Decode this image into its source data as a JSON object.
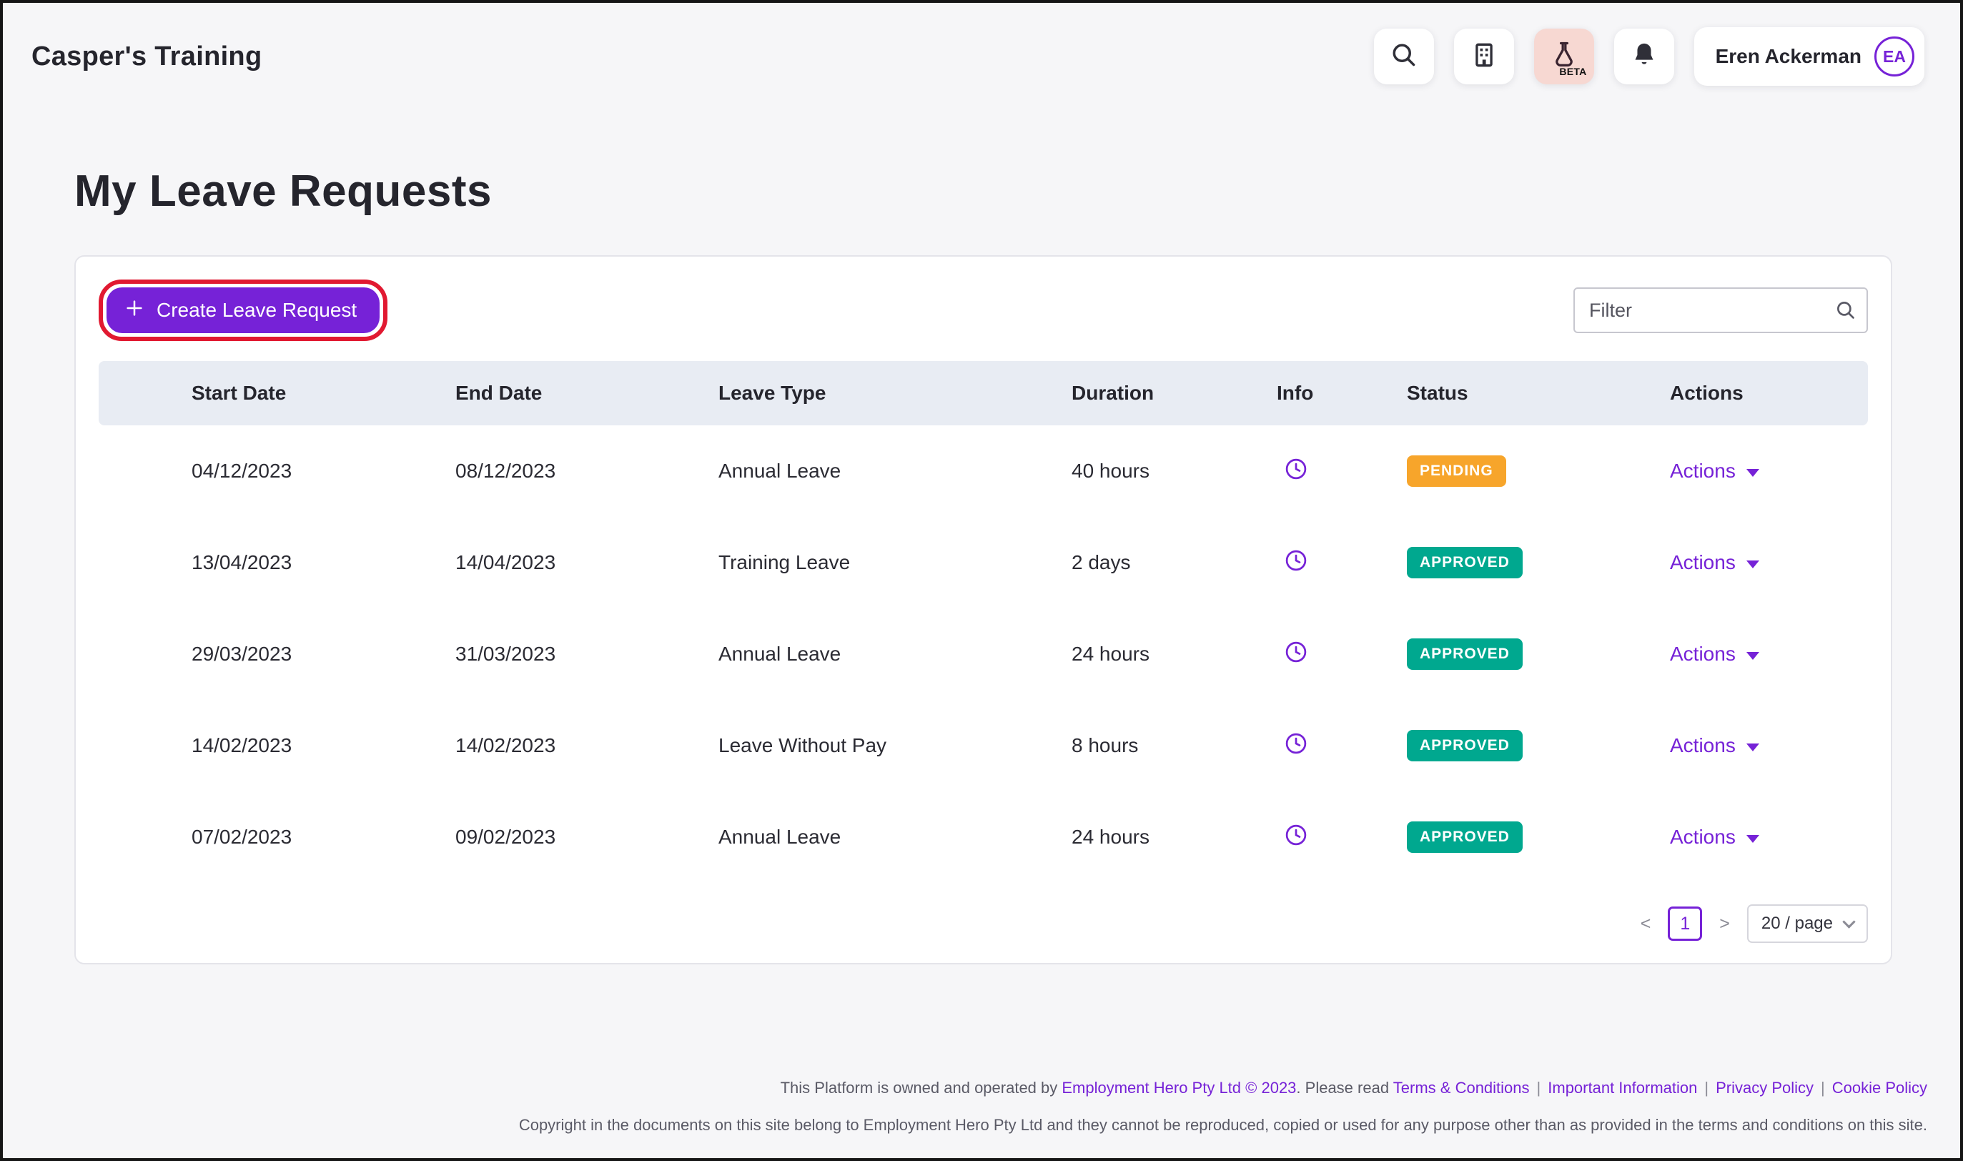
{
  "colors": {
    "accent_purple": "#7622D7",
    "pending_orange": "#F7A52B",
    "approved_teal": "#00A88F",
    "highlight_red": "#E11931",
    "table_header_bg": "#E8ECF3"
  },
  "header": {
    "app_title": "Casper's Training",
    "user_name": "Eren Ackerman",
    "avatar_initials": "EA",
    "beta_label": "BETA"
  },
  "page": {
    "title": "My Leave Requests"
  },
  "toolbar": {
    "create_button_label": "Create Leave Request",
    "filter_placeholder": "Filter"
  },
  "table": {
    "columns": [
      "Start Date",
      "End Date",
      "Leave Type",
      "Duration",
      "Info",
      "Status",
      "Actions"
    ],
    "rows": [
      {
        "start_date": "04/12/2023",
        "end_date": "08/12/2023",
        "leave_type": "Annual Leave",
        "duration": "40 hours",
        "status": "PENDING",
        "actions_label": "Actions"
      },
      {
        "start_date": "13/04/2023",
        "end_date": "14/04/2023",
        "leave_type": "Training Leave",
        "duration": "2 days",
        "status": "APPROVED",
        "actions_label": "Actions"
      },
      {
        "start_date": "29/03/2023",
        "end_date": "31/03/2023",
        "leave_type": "Annual Leave",
        "duration": "24 hours",
        "status": "APPROVED",
        "actions_label": "Actions"
      },
      {
        "start_date": "14/02/2023",
        "end_date": "14/02/2023",
        "leave_type": "Leave Without Pay",
        "duration": "8 hours",
        "status": "APPROVED",
        "actions_label": "Actions"
      },
      {
        "start_date": "07/02/2023",
        "end_date": "09/02/2023",
        "leave_type": "Annual Leave",
        "duration": "24 hours",
        "status": "APPROVED",
        "actions_label": "Actions"
      }
    ]
  },
  "pagination": {
    "prev": "<",
    "current_page": "1",
    "next": ">",
    "page_size": "20 / page"
  },
  "footer": {
    "line1_prefix": "This Platform is owned and operated by ",
    "company_link": "Employment Hero Pty Ltd © 2023",
    "line1_middle": ". Please read ",
    "terms_link": "Terms & Conditions",
    "separator": "|",
    "important_link": "Important Information",
    "privacy_link": "Privacy Policy",
    "cookie_link": "Cookie Policy",
    "line2": "Copyright in the documents on this site belong to Employment Hero Pty Ltd and they cannot be reproduced, copied or used for any purpose other than as provided in the terms and conditions on this site."
  }
}
